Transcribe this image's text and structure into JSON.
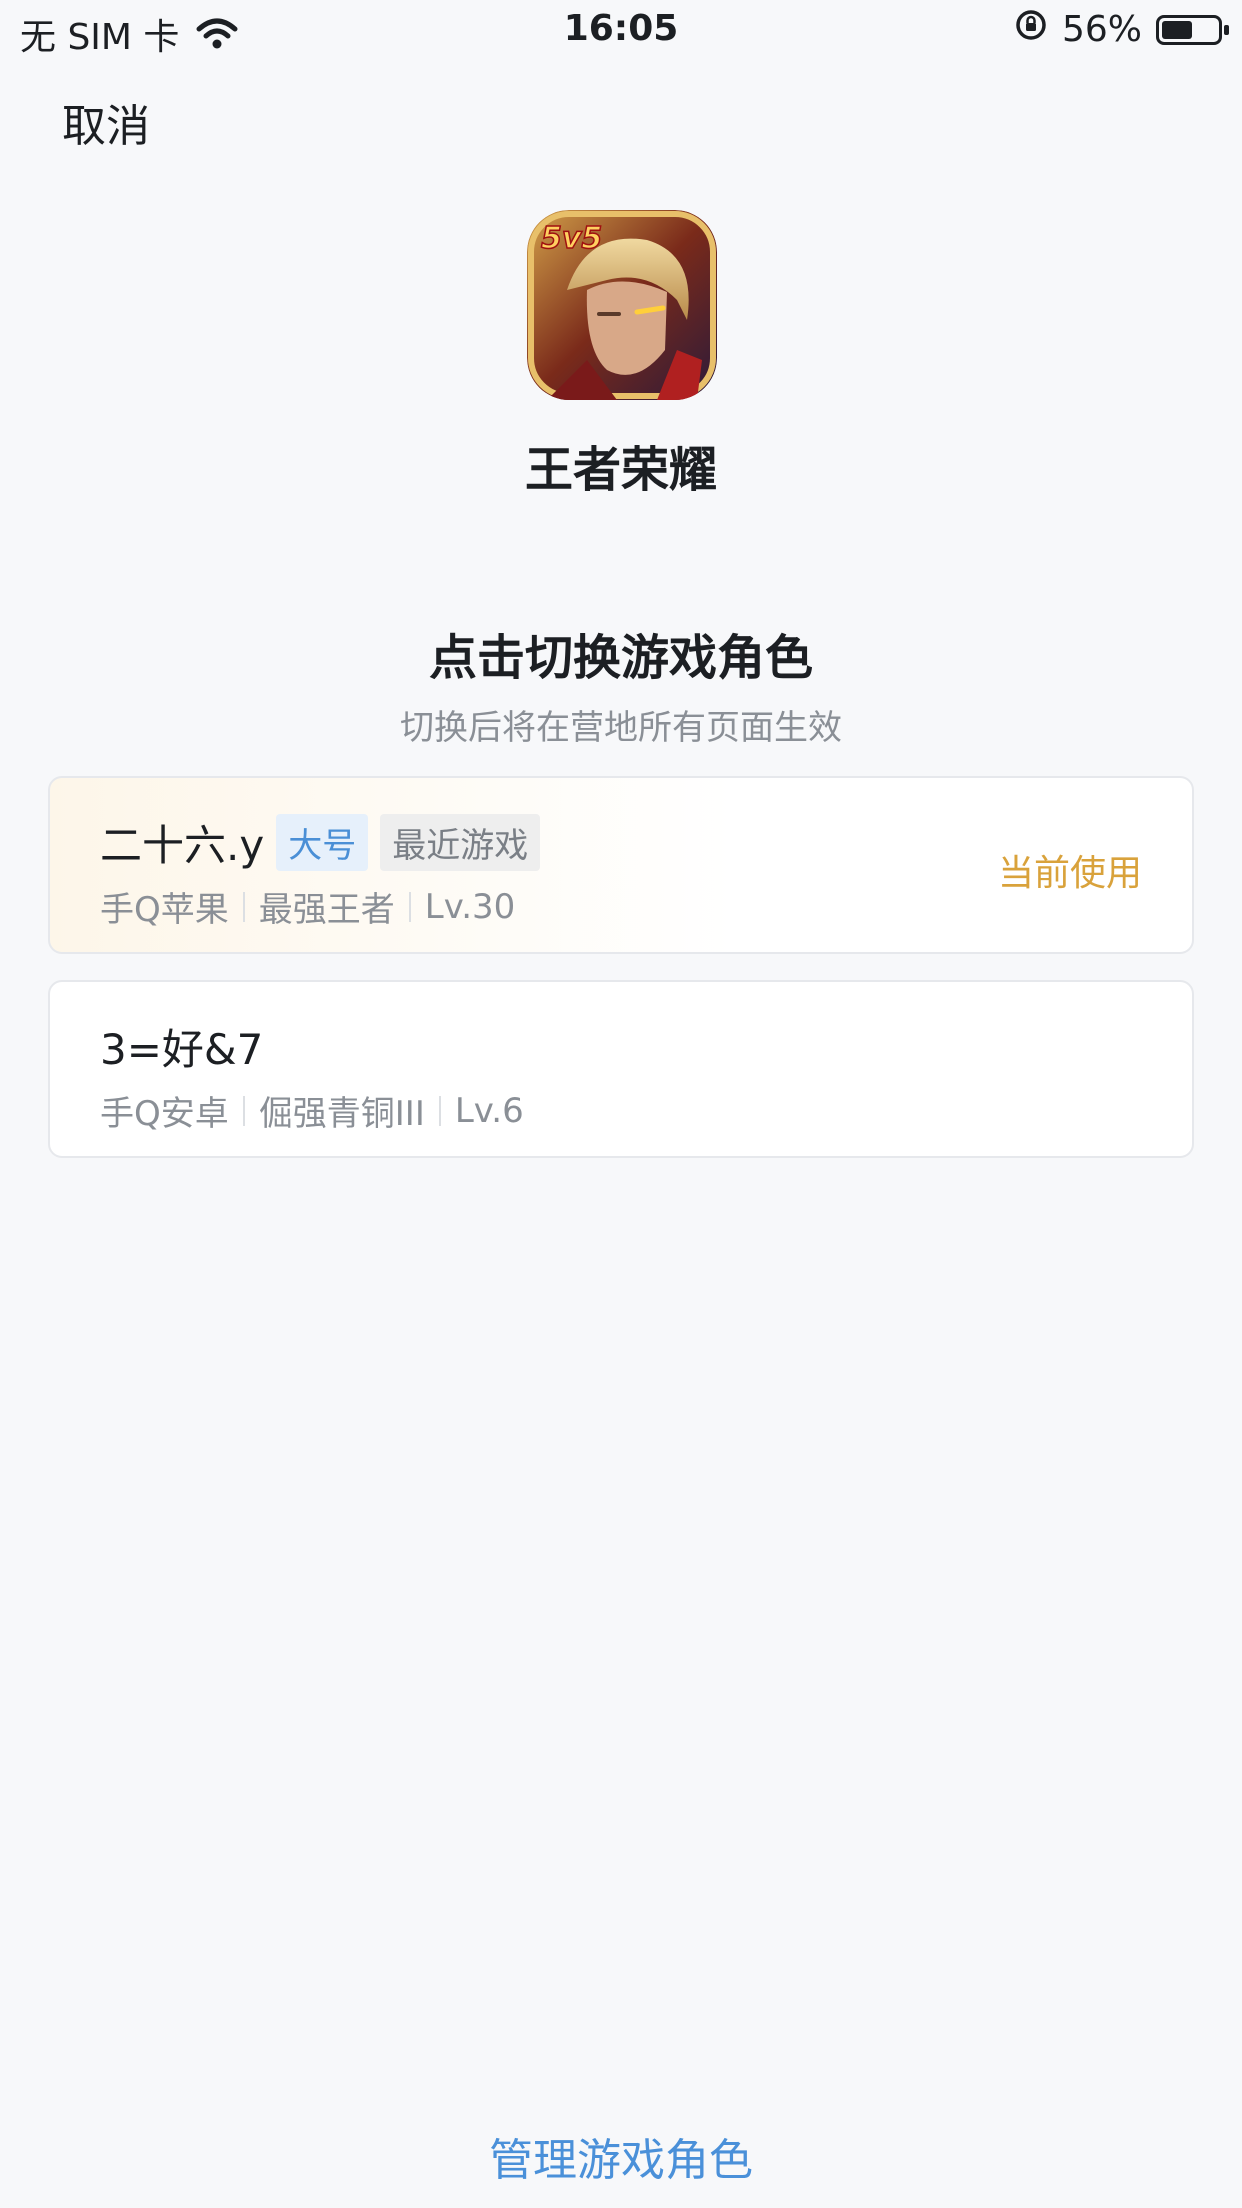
{
  "status_bar": {
    "carrier": "无 SIM 卡",
    "time": "16:05",
    "battery": "56%"
  },
  "header": {
    "cancel_label": "取消"
  },
  "game": {
    "name": "王者荣耀",
    "icon_badge": "5v5"
  },
  "main": {
    "title": "点击切换游戏角色",
    "subtitle": "切换后将在营地所有页面生效",
    "roles": [
      {
        "name": "二十六.y",
        "tags": [
          "大号",
          "最近游戏"
        ],
        "platform": "手Q苹果",
        "rank": "最强王者",
        "level": "Lv.30",
        "status": "当前使用"
      },
      {
        "name": "3=好&7",
        "platform": "手Q安卓",
        "rank": "倔强青铜III",
        "level": "Lv.6"
      }
    ]
  },
  "footer": {
    "manage_label": "管理游戏角色"
  },
  "colors": {
    "background": "#f7f8fa",
    "accent_blue": "#4a90d9",
    "current_gold": "#d9a23b"
  }
}
